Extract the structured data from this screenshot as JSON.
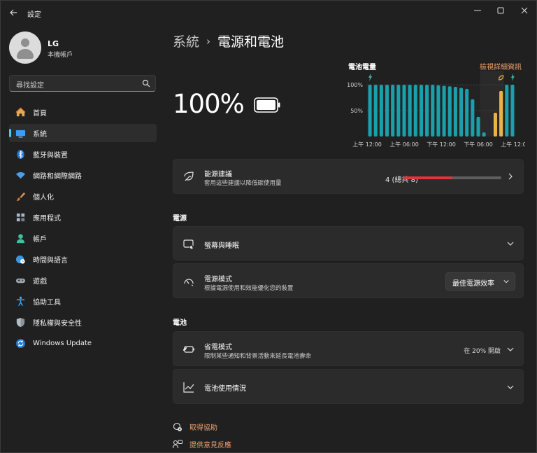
{
  "window": {
    "title": "設定"
  },
  "profile": {
    "name": "LG",
    "account_type": "本機帳戶"
  },
  "search": {
    "placeholder": "尋找設定"
  },
  "nav": {
    "items": [
      {
        "label": "首頁",
        "icon": "home-icon"
      },
      {
        "label": "系統",
        "icon": "system-icon",
        "active": true
      },
      {
        "label": "藍牙與裝置",
        "icon": "bluetooth-icon"
      },
      {
        "label": "網路和網際網路",
        "icon": "wifi-icon"
      },
      {
        "label": "個人化",
        "icon": "brush-icon"
      },
      {
        "label": "應用程式",
        "icon": "apps-icon"
      },
      {
        "label": "帳戶",
        "icon": "account-icon"
      },
      {
        "label": "時間與語言",
        "icon": "globe-clock-icon"
      },
      {
        "label": "遊戲",
        "icon": "gamepad-icon"
      },
      {
        "label": "協助工具",
        "icon": "accessibility-icon"
      },
      {
        "label": "隱私權與安全性",
        "icon": "shield-icon"
      },
      {
        "label": "Windows Update",
        "icon": "update-icon"
      }
    ]
  },
  "breadcrumb": {
    "parent": "系統",
    "current": "電源和電池"
  },
  "battery": {
    "percent_text": "100%"
  },
  "chart_data": {
    "type": "bar",
    "title": "電池電量",
    "link_text": "檢視詳細資訊",
    "y_ticks": [
      "100%",
      "50%"
    ],
    "ylim": [
      0,
      100
    ],
    "x_tick_labels": [
      "上午 12:00",
      "上午 06:00",
      "下午 12:00",
      "下午 06:00",
      "上午 12:00"
    ],
    "values": [
      100,
      100,
      100,
      100,
      100,
      100,
      100,
      100,
      100,
      100,
      100,
      100,
      99,
      98,
      97,
      96,
      94,
      92,
      72,
      38,
      8,
      0,
      46,
      88,
      100,
      100
    ],
    "charging": [
      false,
      false,
      false,
      false,
      false,
      false,
      false,
      false,
      false,
      false,
      false,
      false,
      false,
      false,
      false,
      false,
      false,
      false,
      false,
      false,
      false,
      false,
      true,
      true,
      false,
      false
    ],
    "plug_markers": [
      {
        "index": 0,
        "type": "plug"
      },
      {
        "index": 23,
        "type": "plug"
      },
      {
        "index": 25,
        "type": "plug"
      }
    ],
    "saver_marker_index": 23,
    "colors": {
      "normal": "#1a9fab",
      "charging": "#e9b34a",
      "marker": "#3cb1a0",
      "saver": "#e9b34a"
    },
    "grid": true
  },
  "energy": {
    "title": "能源建議",
    "subtitle": "套用這些建議以降低碳使用量",
    "count_text": "4 (總共 8)",
    "progress": 0.5,
    "progress_color": "#e0363b"
  },
  "power_section": {
    "title": "電源"
  },
  "screen_sleep": {
    "title": "螢幕與睡眠"
  },
  "power_mode": {
    "title": "電源模式",
    "subtitle": "根據電源使用和效能優化您的裝置",
    "selected": "最佳電源效率"
  },
  "battery_section": {
    "title": "電池"
  },
  "battery_saver": {
    "title": "省電模式",
    "subtitle": "限制某些通知和背景活動來延長電池壽命",
    "status": "在 20% 開啟"
  },
  "battery_usage": {
    "title": "電池使用情況"
  },
  "help": {
    "get_help": "取得協助",
    "feedback": "提供意見反應"
  }
}
